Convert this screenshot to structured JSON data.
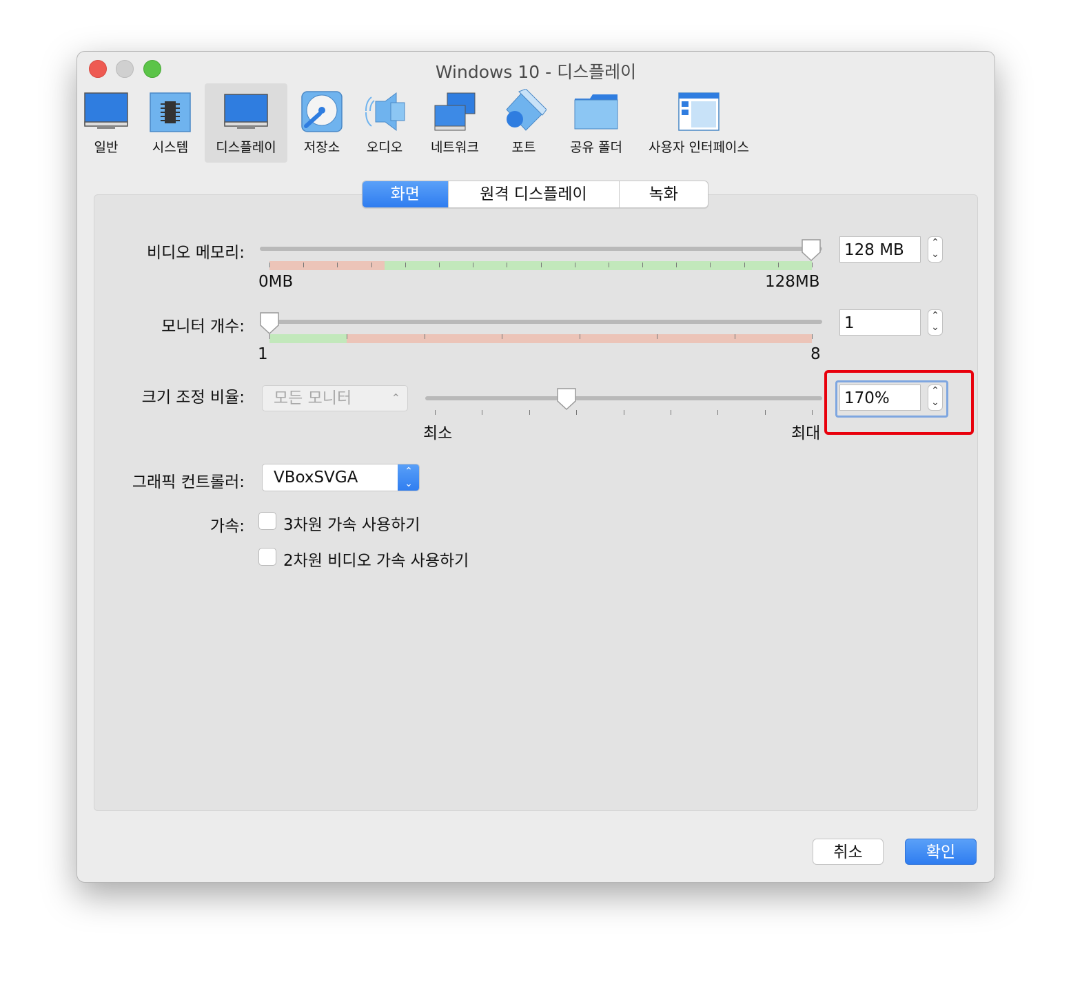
{
  "window": {
    "title": "Windows 10 - 디스플레이"
  },
  "toolbar": {
    "items": [
      {
        "label": "일반",
        "icon": "general-monitor-icon"
      },
      {
        "label": "시스템",
        "icon": "system-chip-icon"
      },
      {
        "label": "디스플레이",
        "icon": "display-monitor-icon",
        "selected": true
      },
      {
        "label": "저장소",
        "icon": "storage-disk-icon"
      },
      {
        "label": "오디오",
        "icon": "audio-speaker-icon"
      },
      {
        "label": "네트워크",
        "icon": "network-icon"
      },
      {
        "label": "포트",
        "icon": "port-plug-icon"
      },
      {
        "label": "공유 폴더",
        "icon": "shared-folder-icon"
      },
      {
        "label": "사용자 인터페이스",
        "icon": "user-interface-icon"
      }
    ]
  },
  "tabs": [
    {
      "label": "화면",
      "active": true
    },
    {
      "label": "원격 디스플레이",
      "active": false
    },
    {
      "label": "녹화",
      "active": false
    }
  ],
  "video_memory": {
    "label": "비디오 메모리:",
    "value_text": "128 MB",
    "min_label": "0MB",
    "max_label": "128MB",
    "value": 128,
    "min": 0,
    "max": 128
  },
  "monitor_count": {
    "label": "모니터 개수:",
    "value_text": "1",
    "min_label": "1",
    "max_label": "8",
    "value": 1,
    "min": 1,
    "max": 8
  },
  "scale_factor": {
    "label": "크기 조정 비율:",
    "monitor_select": "모든 모니터",
    "value_text": "170%",
    "min_label": "최소",
    "max_label": "최대",
    "slider_fraction": 0.33
  },
  "graphics_controller": {
    "label": "그래픽 컨트롤러:",
    "value": "VBoxSVGA"
  },
  "acceleration": {
    "label": "가속:",
    "option_3d": "3차원 가속 사용하기",
    "option_2d": "2차원 비디오 가속 사용하기",
    "checked_3d": false,
    "checked_2d": false
  },
  "buttons": {
    "cancel": "취소",
    "ok": "확인"
  },
  "colors": {
    "accent": "#3b86f3",
    "highlight": "#e8000c",
    "ok_zone": "#c2e8bb",
    "bad_zone": "#ecc4b8"
  }
}
